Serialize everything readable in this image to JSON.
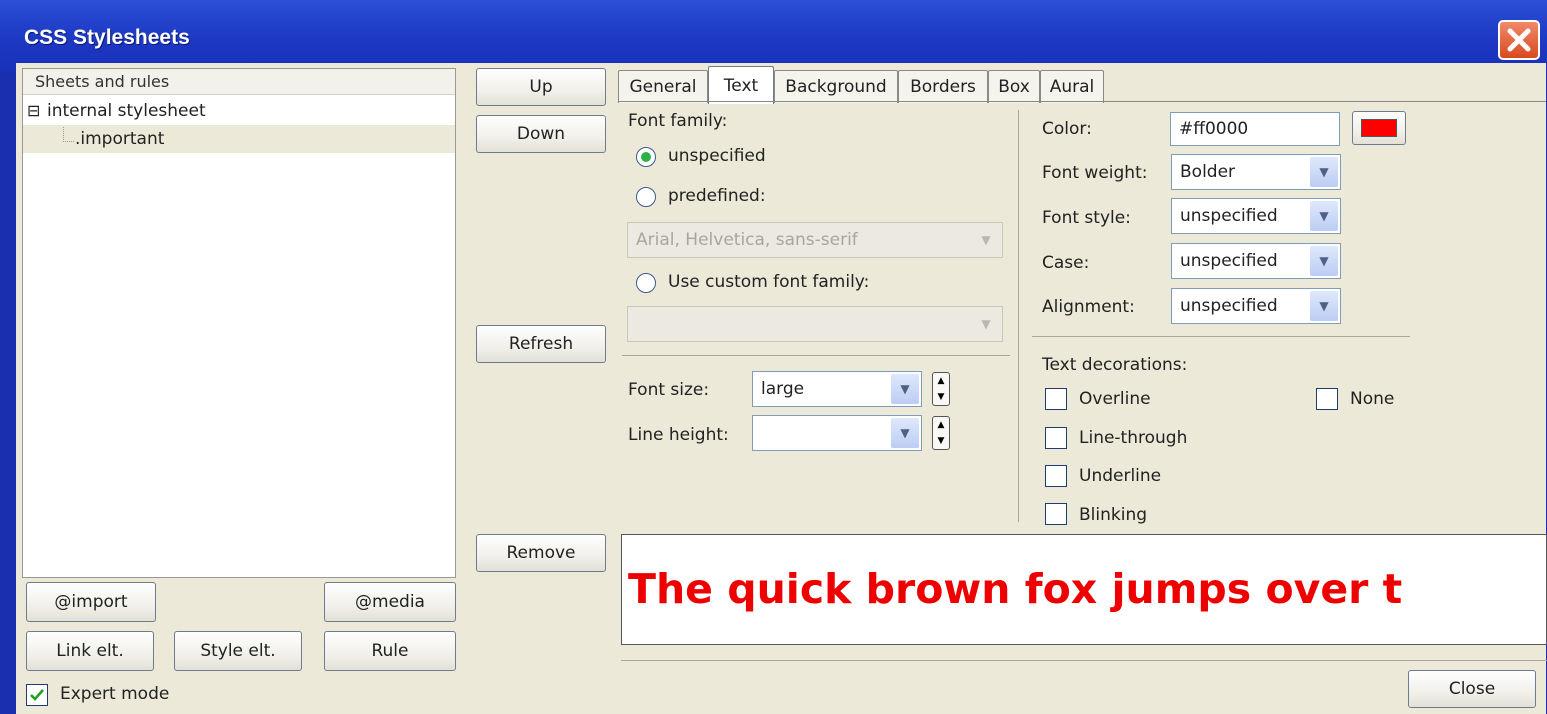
{
  "window": {
    "title": "CSS Stylesheets"
  },
  "sheets": {
    "header": "Sheets and rules",
    "tree": [
      {
        "label": "internal stylesheet",
        "expander": "⊟"
      },
      {
        "label": ".important"
      }
    ]
  },
  "side_buttons": {
    "up": "Up",
    "down": "Down",
    "refresh": "Refresh",
    "remove": "Remove"
  },
  "bottom_buttons": {
    "import": "@import",
    "media": "@media",
    "link": "Link elt.",
    "style": "Style elt.",
    "rule": "Rule"
  },
  "expert_mode": {
    "label": "Expert mode",
    "checked": true
  },
  "tabs": [
    {
      "label": "General"
    },
    {
      "label": "Text",
      "active": true
    },
    {
      "label": "Background"
    },
    {
      "label": "Borders"
    },
    {
      "label": "Box"
    },
    {
      "label": "Aural"
    }
  ],
  "font_family": {
    "label": "Font family:",
    "opt_unspecified": "unspecified",
    "opt_predefined": "predefined:",
    "predefined_value": "Arial, Helvetica, sans-serif",
    "opt_custom": "Use custom font family:",
    "custom_value": ""
  },
  "font_size": {
    "label": "Font size:",
    "value": "large"
  },
  "line_height": {
    "label": "Line height:",
    "value": ""
  },
  "color": {
    "label": "Color:",
    "value": "#ff0000",
    "swatch": "#ff0000"
  },
  "font_weight": {
    "label": "Font weight:",
    "value": "Bolder"
  },
  "font_style": {
    "label": "Font style:",
    "value": "unspecified"
  },
  "case": {
    "label": "Case:",
    "value": "unspecified"
  },
  "alignment": {
    "label": "Alignment:",
    "value": "unspecified"
  },
  "text_decorations": {
    "label": "Text decorations:",
    "overline": "Overline",
    "line_through": "Line-through",
    "underline": "Underline",
    "blinking": "Blinking",
    "none": "None"
  },
  "preview": {
    "text": "The quick brown fox jumps over t"
  },
  "close_button": "Close"
}
